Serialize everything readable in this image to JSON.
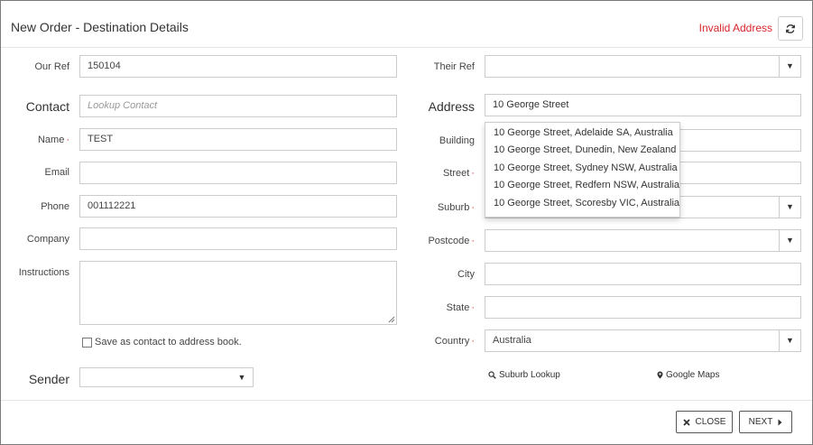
{
  "header": {
    "title": "New Order - Destination Details",
    "status": "Invalid Address"
  },
  "left": {
    "our_ref": {
      "label": "Our Ref",
      "value": "150104"
    },
    "contact": {
      "label": "Contact",
      "placeholder": "Lookup Contact"
    },
    "name": {
      "label": "Name",
      "value": "TEST"
    },
    "email": {
      "label": "Email",
      "value": ""
    },
    "phone": {
      "label": "Phone",
      "value": "001112221"
    },
    "company": {
      "label": "Company",
      "value": ""
    },
    "instructions": {
      "label": "Instructions",
      "value": ""
    },
    "save_contact": {
      "label": "Save as contact to address book.",
      "checked": false
    },
    "sender": {
      "label": "Sender",
      "value": ""
    }
  },
  "right": {
    "their_ref": {
      "label": "Their Ref",
      "value": ""
    },
    "address": {
      "label": "Address",
      "value": "10 George Street"
    },
    "building": {
      "label": "Building",
      "value": ""
    },
    "street": {
      "label": "Street",
      "value": ""
    },
    "suburb": {
      "label": "Suburb",
      "value": ""
    },
    "postcode": {
      "label": "Postcode",
      "value": ""
    },
    "city": {
      "label": "City",
      "value": ""
    },
    "state": {
      "label": "State",
      "value": ""
    },
    "country": {
      "label": "Country",
      "value": "Australia"
    },
    "suburb_lookup": "Suburb Lookup",
    "google_maps": "Google Maps"
  },
  "suggestions": [
    "10 George Street, Adelaide SA, Australia",
    "10 George Street, Dunedin, New Zealand",
    "10 George Street, Sydney NSW, Australia",
    "10 George Street, Redfern NSW, Australia",
    "10 George Street, Scoresby VIC, Australia"
  ],
  "footer": {
    "close_label": "CLOSE",
    "next_label": "NEXT"
  },
  "colors": {
    "error": "#d9262c",
    "border": "#cccccc"
  },
  "icons": {
    "refresh": "refresh-icon",
    "close": "close-icon",
    "next": "caret-right-icon",
    "search": "search-icon",
    "map": "map-marker-icon",
    "dropdown": "caret-down-icon"
  }
}
